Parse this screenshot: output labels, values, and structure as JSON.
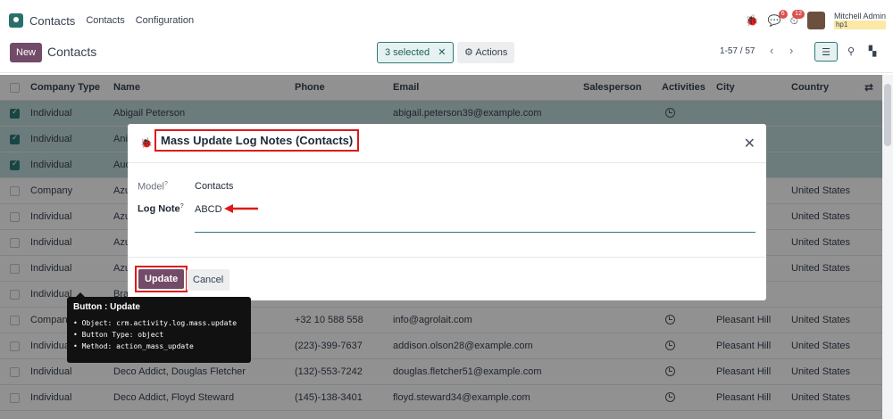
{
  "navbar": {
    "app_name": "Contacts",
    "menu": [
      "Contacts",
      "Configuration"
    ],
    "messages_count": "6",
    "activities_count": "12",
    "user_name": "Mitchell Admin",
    "db_name": "hp1"
  },
  "control_panel": {
    "new_label": "New",
    "title": "Contacts",
    "selected_label": "3 selected",
    "actions_label": "Actions",
    "pager": "1-57 / 57"
  },
  "table": {
    "columns": [
      "Company Type",
      "Name",
      "Phone",
      "Email",
      "Salesperson",
      "Activities",
      "City",
      "Country"
    ],
    "rows": [
      {
        "type": "Individual",
        "name": "Abigail Peterson",
        "phone": "",
        "email": "abigail.peterson39@example.com",
        "city": "",
        "country": "",
        "selected": true,
        "activity": true
      },
      {
        "type": "Individual",
        "name": "Ani",
        "phone": "",
        "email": "",
        "city": "",
        "country": "",
        "selected": true,
        "activity": false
      },
      {
        "type": "Individual",
        "name": "Aud",
        "phone": "",
        "email": "",
        "city": "",
        "country": "",
        "selected": true,
        "activity": false
      },
      {
        "type": "Company",
        "name": "Azu",
        "phone": "",
        "email": "",
        "city": "",
        "country": "United States",
        "selected": false,
        "activity": false
      },
      {
        "type": "Individual",
        "name": "Azu",
        "phone": "",
        "email": "",
        "city": "",
        "country": "United States",
        "selected": false,
        "activity": false
      },
      {
        "type": "Individual",
        "name": "Azu",
        "phone": "",
        "email": "",
        "city": "",
        "country": "United States",
        "selected": false,
        "activity": false
      },
      {
        "type": "Individual",
        "name": "Azu",
        "phone": "",
        "email": "",
        "city": "",
        "country": "United States",
        "selected": false,
        "activity": false
      },
      {
        "type": "Individual",
        "name": "Bra",
        "phone": "",
        "email": "",
        "city": "",
        "country": "",
        "selected": false,
        "activity": false
      },
      {
        "type": "Company",
        "name": "Dec",
        "phone": "+32 10 588 558",
        "email": "info@agrolait.com",
        "city": "Pleasant Hill",
        "country": "United States",
        "selected": false,
        "activity": true
      },
      {
        "type": "Individual",
        "name": "Dec",
        "phone": "(223)-399-7637",
        "email": "addison.olson28@example.com",
        "city": "Pleasant Hill",
        "country": "United States",
        "selected": false,
        "activity": true
      },
      {
        "type": "Individual",
        "name": "Deco Addict, Douglas Fletcher",
        "phone": "(132)-553-7242",
        "email": "douglas.fletcher51@example.com",
        "city": "Pleasant Hill",
        "country": "United States",
        "selected": false,
        "activity": true
      },
      {
        "type": "Individual",
        "name": "Deco Addict, Floyd Steward",
        "phone": "(145)-138-3401",
        "email": "floyd.steward34@example.com",
        "city": "Pleasant Hill",
        "country": "United States",
        "selected": false,
        "activity": true
      }
    ]
  },
  "modal": {
    "title": "Mass Update Log Notes (Contacts)",
    "model_label": "Model",
    "model_value": "Contacts",
    "log_note_label": "Log Note",
    "help_mark": "?",
    "log_note_value": "ABCD",
    "update_label": "Update",
    "cancel_label": "Cancel"
  },
  "tooltip": {
    "title": "Button : Update",
    "items": [
      "Object: crm.activity.log.mass.update",
      "Button Type: object",
      "Method: action_mass_update"
    ]
  },
  "colors": {
    "primary": "#714b67",
    "teal": "#2d7a78",
    "annotation_red": "#e01818",
    "selected_row": "#bfd9db"
  }
}
